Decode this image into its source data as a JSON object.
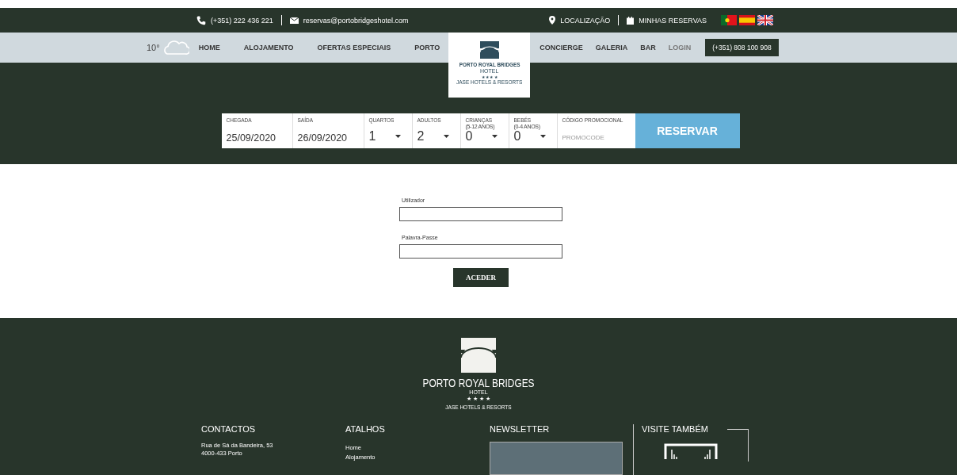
{
  "top_bar": {
    "phone": "(+351) 222 436 221",
    "email": "reservas@portobridgeshotel.com",
    "location": "LOCALIZAÇÃO",
    "bookings": "MINHAS RESERVAS",
    "languages": [
      {
        "kind": "pt"
      },
      {
        "kind": "es"
      },
      {
        "kind": "uk"
      }
    ]
  },
  "nav": {
    "temperature": "10°",
    "left": [
      {
        "label": "HOME"
      },
      {
        "label": "ALOJAMENTO"
      },
      {
        "label": "OFERTAS ESPECIAIS"
      },
      {
        "label": "PORTO"
      }
    ],
    "right": [
      {
        "label": "CONCIERGE",
        "kind": "link"
      },
      {
        "label": "GALERIA",
        "kind": "link"
      },
      {
        "label": "BAR",
        "kind": "link"
      },
      {
        "label": "LOGIN",
        "kind": "muted"
      },
      {
        "label": "(+351) 808 100 908",
        "kind": "phone"
      }
    ]
  },
  "logo": {
    "name": "PORTO ROYAL BRIDGES",
    "sub": "HOTEL",
    "stars": "★ ★ ★ ★",
    "group": "JASE HOTELS & RESORTS"
  },
  "booking": {
    "fields": [
      {
        "label": "CHEGADA",
        "value": "25/09/2020",
        "kind": "date"
      },
      {
        "label": "SAÍDA",
        "value": "26/09/2020",
        "kind": "date"
      },
      {
        "label": "QUARTOS",
        "value": "1",
        "kind": "select"
      },
      {
        "label": "ADULTOS",
        "value": "2",
        "kind": "select"
      },
      {
        "label": "CRIANÇAS",
        "note": "(5-12 ANOS)",
        "value": "0",
        "kind": "select"
      },
      {
        "label": "BEBÉS",
        "note": "(0-4 ANOS)",
        "value": "0",
        "kind": "select"
      },
      {
        "label": "CÓDIGO PROMOCIONAL",
        "placeholder": "PROMOCODE",
        "kind": "text"
      }
    ],
    "button": "RESERVAR"
  },
  "login": {
    "user_label": "Utilizador",
    "password_label": "Palavra-Passe",
    "button": "ACEDER"
  },
  "footer": {
    "logo": {
      "name": "PORTO ROYAL BRIDGES",
      "sub": "HOTEL",
      "stars": "★ ★ ★ ★",
      "group": "JASE HOTELS & RESORTS"
    },
    "contacts": {
      "title": "CONTACTOS",
      "lines": [
        "Rua de Sá da Bandeira, 53",
        "4000-433 Porto"
      ]
    },
    "shortcuts": {
      "title": "ATALHOS",
      "links": [
        "Home",
        "Alojamento"
      ]
    },
    "newsletter": {
      "title": "NEWSLETTER"
    },
    "visit": {
      "title": "VISITE TAMBÉM"
    }
  }
}
